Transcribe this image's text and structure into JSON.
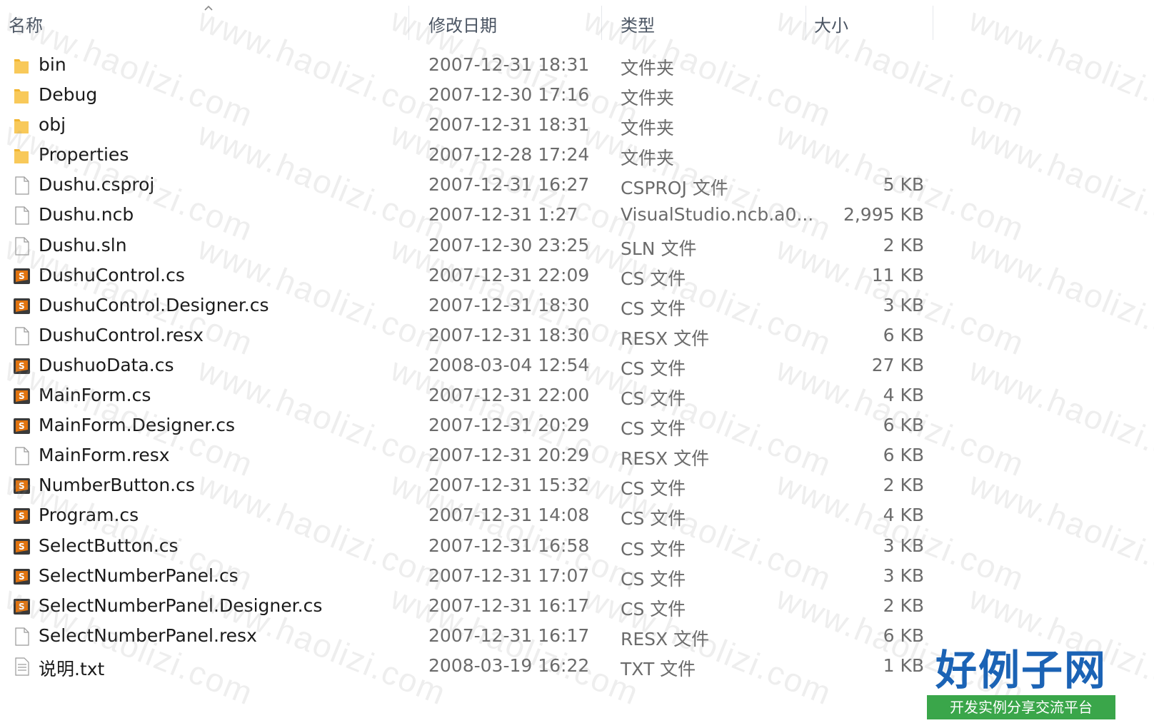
{
  "header": {
    "name": "名称",
    "modified": "修改日期",
    "type": "类型",
    "size": "大小"
  },
  "files": [
    {
      "name": "bin",
      "modified": "2007-12-31 18:31",
      "type": "文件夹",
      "size": "",
      "icon": "folder-icon"
    },
    {
      "name": "Debug",
      "modified": "2007-12-30 17:16",
      "type": "文件夹",
      "size": "",
      "icon": "folder-icon"
    },
    {
      "name": "obj",
      "modified": "2007-12-31 18:31",
      "type": "文件夹",
      "size": "",
      "icon": "folder-icon"
    },
    {
      "name": "Properties",
      "modified": "2007-12-28 17:24",
      "type": "文件夹",
      "size": "",
      "icon": "folder-icon"
    },
    {
      "name": "Dushu.csproj",
      "modified": "2007-12-31 16:27",
      "type": "CSPROJ 文件",
      "size": "5 KB",
      "icon": "file-icon"
    },
    {
      "name": "Dushu.ncb",
      "modified": "2007-12-31 1:27",
      "type": "VisualStudio.ncb.a0...",
      "size": "2,995 KB",
      "icon": "file-icon"
    },
    {
      "name": "Dushu.sln",
      "modified": "2007-12-30 23:25",
      "type": "SLN 文件",
      "size": "2 KB",
      "icon": "file-icon"
    },
    {
      "name": "DushuControl.cs",
      "modified": "2007-12-31 22:09",
      "type": "CS 文件",
      "size": "11 KB",
      "icon": "cs-file-icon"
    },
    {
      "name": "DushuControl.Designer.cs",
      "modified": "2007-12-31 18:30",
      "type": "CS 文件",
      "size": "3 KB",
      "icon": "cs-file-icon"
    },
    {
      "name": "DushuControl.resx",
      "modified": "2007-12-31 18:30",
      "type": "RESX 文件",
      "size": "6 KB",
      "icon": "file-icon"
    },
    {
      "name": "DushuoData.cs",
      "modified": "2008-03-04 12:54",
      "type": "CS 文件",
      "size": "27 KB",
      "icon": "cs-file-icon"
    },
    {
      "name": "MainForm.cs",
      "modified": "2007-12-31 22:00",
      "type": "CS 文件",
      "size": "4 KB",
      "icon": "cs-file-icon"
    },
    {
      "name": "MainForm.Designer.cs",
      "modified": "2007-12-31 20:29",
      "type": "CS 文件",
      "size": "6 KB",
      "icon": "cs-file-icon"
    },
    {
      "name": "MainForm.resx",
      "modified": "2007-12-31 20:29",
      "type": "RESX 文件",
      "size": "6 KB",
      "icon": "file-icon"
    },
    {
      "name": "NumberButton.cs",
      "modified": "2007-12-31 15:32",
      "type": "CS 文件",
      "size": "2 KB",
      "icon": "cs-file-icon"
    },
    {
      "name": "Program.cs",
      "modified": "2007-12-31 14:08",
      "type": "CS 文件",
      "size": "4 KB",
      "icon": "cs-file-icon"
    },
    {
      "name": "SelectButton.cs",
      "modified": "2007-12-31 16:58",
      "type": "CS 文件",
      "size": "3 KB",
      "icon": "cs-file-icon"
    },
    {
      "name": "SelectNumberPanel.cs",
      "modified": "2007-12-31 17:07",
      "type": "CS 文件",
      "size": "3 KB",
      "icon": "cs-file-icon"
    },
    {
      "name": "SelectNumberPanel.Designer.cs",
      "modified": "2007-12-31 16:17",
      "type": "CS 文件",
      "size": "2 KB",
      "icon": "cs-file-icon"
    },
    {
      "name": "SelectNumberPanel.resx",
      "modified": "2007-12-31 16:17",
      "type": "RESX 文件",
      "size": "6 KB",
      "icon": "file-icon"
    },
    {
      "name": "说明.txt",
      "modified": "2008-03-19 16:22",
      "type": "TXT 文件",
      "size": "1 KB",
      "icon": "text-file-icon"
    }
  ],
  "watermark": "www.haolizi.com",
  "logo": {
    "main": "好例子网",
    "sub": "开发实例分享交流平台"
  },
  "colors": {
    "folder": "#f2b530",
    "cs_icon": "#e0730f",
    "logo_blue": "#1b63b5",
    "logo_green": "#3aa64a"
  }
}
